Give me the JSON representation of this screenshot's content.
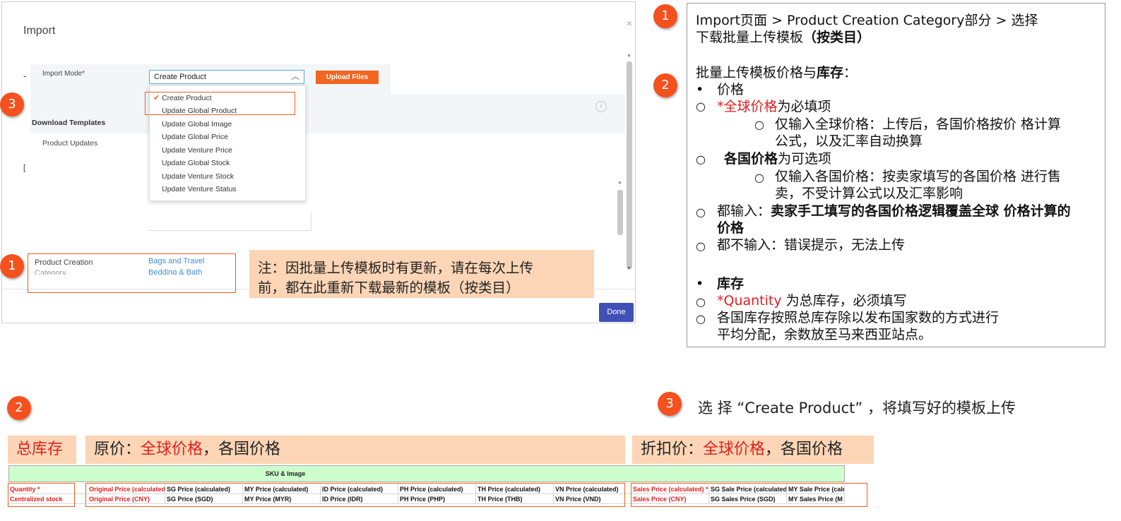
{
  "dialog": {
    "title": "Import",
    "close": "×",
    "import_mode_label": "Import Mode*",
    "import_mode_value": "Create Product",
    "upload_button": "Upload Files",
    "download_templates": "Download Templates",
    "product_updates": "Product Updates",
    "dropdown_options": [
      "Create Product",
      "Update Global Product",
      "Update Global Image",
      "Update Global Price",
      "Update Venture Price",
      "Update Global Stock",
      "Update Venture Stock",
      "Update Venture Status"
    ],
    "selected_option": "Create Product",
    "product_creation_label": "Product Creation",
    "product_creation_label2": "Category",
    "category_1": "Bags and Travel",
    "category_2": "Bedding & Bath",
    "done_button": "Done",
    "note": "注：因批量上传模板时有更新，请在每次上传前，都在此重新下载最新的模板（按类目）",
    "note_line1": "注：因批量上传模板时有更新，请在每次上传",
    "note_line2": "前，都在此重新下载最新的模板（按类目）"
  },
  "badges": {
    "one": "1",
    "two": "2",
    "three": "3"
  },
  "panel": {
    "step1_line1": "Import页面 >  Product Creation Category部分 >     选择",
    "step1_line2_a": "下载批量上传模板",
    "step1_line2_b": "（按类目）",
    "section_title_a": "批量上传模板价格与",
    "section_title_b": "库存",
    "section_title_c": "：",
    "price": "价格",
    "global_price_red": "*全球价格",
    "global_price_rest": "为必填项",
    "global_only_1": "仅输入全球价格：上传后，各国价格按价 格计算",
    "global_only_2": "公式，以及汇率自动换算",
    "country_price_b": "各国价格",
    "country_price_rest": "为可选项",
    "country_only_1": "仅输入各国价格：按卖家填写的各国价格 进行售",
    "country_only_2": "卖，不受计算公式以及汇率影响",
    "both_a": "都输入：",
    "both_b": "卖家手工填写的各国价格逻辑覆盖全球 价格计算的",
    "both_c": "价格",
    "neither": "都不输入：错误提示，无法上传",
    "stock": "库存",
    "quantity_red": "*Quantity",
    "quantity_rest": " 为总库存，必须填写",
    "stock_split_1": "各国库存按照总库存除以发布国家数的方式进行",
    "stock_split_2": "平均分配，余数放至马来西亚站点。",
    "bullet": "•",
    "circle": "○"
  },
  "bottom": {
    "step3_text": "选 择 “Create Product” ，将填写好的模板上传",
    "label_total_stock": "总库存",
    "label_orig_a": "原价：",
    "label_orig_red": "全球价格",
    "label_orig_b": "，各国价格",
    "label_disc_a": "折扣价：",
    "label_disc_red": "全球价格",
    "label_disc_b": "，各国价格",
    "sku_header": "SKU & Image",
    "row1": [
      "Quantity *",
      "Original Price (calculated",
      "SG Price (calculated)",
      "MY Price (calculated)",
      "ID Price (calculated)",
      "PH Price (calculated)",
      "TH Price (calculated)",
      "VN Price (calculated)",
      "Sales Price (calculated) *",
      "SG Sale Price (calculated",
      "MY Sale Price (calc"
    ],
    "row2": [
      "Centralized stock",
      "Original Price (CNY)",
      "SG Price (SGD)",
      "MY Price (MYR)",
      "ID Price (IDR)",
      "PH Price (PHP)",
      "TH Price (THB)",
      "VN Price (VND)",
      "Sales Price (CNY)",
      "SG Sales Price (SGD)",
      "MY Sales Price (M"
    ]
  },
  "colors": {
    "accent_orange": "#f26522",
    "badge_orange": "#f4511e",
    "highlight_peach": "#fbd5b5",
    "emphasis_red": "#e02020",
    "done_blue": "#3f51b5",
    "sku_green": "#ccffcc"
  }
}
